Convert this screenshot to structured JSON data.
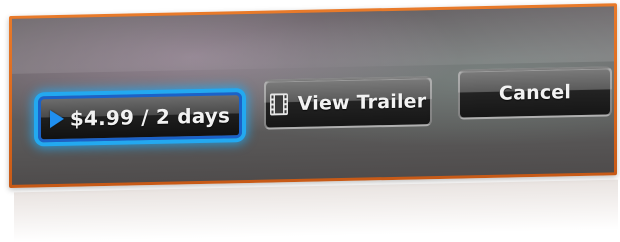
{
  "buttons": {
    "rent_label": "$4.99 / 2 days",
    "trailer_label": "View Trailer",
    "cancel_label": "Cancel"
  },
  "icons": {
    "rent": "play-icon",
    "trailer": "film-icon"
  },
  "colors": {
    "focus_glow": "#23a9f0",
    "frame": "#e07020",
    "play_icon": "#1f8ff0"
  }
}
